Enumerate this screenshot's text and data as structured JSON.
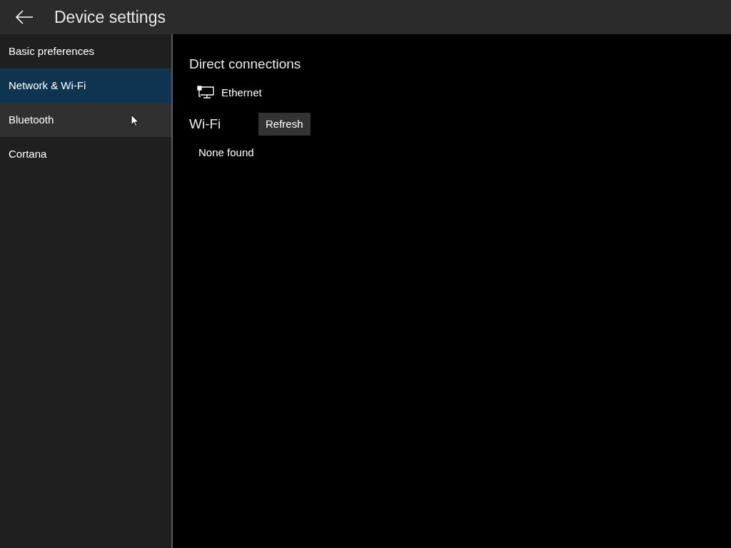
{
  "header": {
    "title": "Device settings"
  },
  "sidebar": {
    "items": [
      {
        "label": "Basic preferences",
        "selected": false,
        "hovered": false
      },
      {
        "label": "Network & Wi-Fi",
        "selected": true,
        "hovered": false
      },
      {
        "label": "Bluetooth",
        "selected": false,
        "hovered": true
      },
      {
        "label": "Cortana",
        "selected": false,
        "hovered": false
      }
    ]
  },
  "direct_connections": {
    "heading": "Direct connections",
    "items": [
      {
        "label": "Ethernet"
      }
    ]
  },
  "wifi": {
    "heading": "Wi-Fi",
    "refresh_button": "Refresh",
    "status": "None found"
  }
}
